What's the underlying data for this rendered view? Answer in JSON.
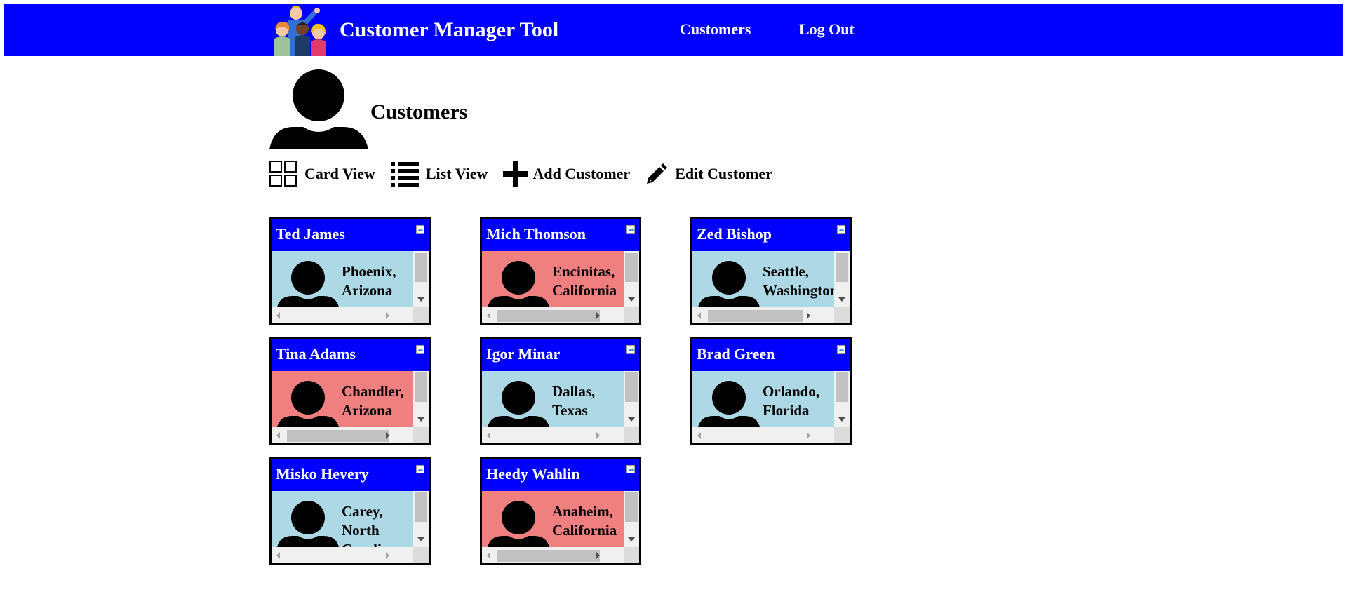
{
  "header": {
    "title": "Customer Manager Tool",
    "nav": [
      {
        "label": "Customers"
      },
      {
        "label": "Log Out"
      }
    ],
    "bg_color": "#0000ff"
  },
  "page": {
    "title": "Customers"
  },
  "toolbar": {
    "card_view": "Card View",
    "list_view": "List View",
    "add_customer": "Add Customer",
    "edit_customer": "Edit Customer"
  },
  "customers": [
    {
      "name": "Ted James",
      "city": "Phoenix,",
      "state": "Arizona",
      "color": "blue"
    },
    {
      "name": "Mich Thomson",
      "city": "Encinitas,",
      "state": "California",
      "color": "red"
    },
    {
      "name": "Zed Bishop",
      "city": "Seattle,",
      "state": "Washington",
      "color": "blue"
    },
    {
      "name": "Tina Adams",
      "city": "Chandler,",
      "state": "Arizona",
      "color": "red"
    },
    {
      "name": "Igor Minar",
      "city": "Dallas,",
      "state": "Texas",
      "color": "blue"
    },
    {
      "name": "Brad Green",
      "city": "Orlando,",
      "state": "Florida",
      "color": "blue"
    },
    {
      "name": "Misko Hevery",
      "city": "Carey,",
      "state": "North Carolina",
      "color": "blue"
    },
    {
      "name": "Heedy Wahlin",
      "city": "Anaheim,",
      "state": "California",
      "color": "red"
    }
  ],
  "colors": {
    "card_blue": "#add8e6",
    "card_red": "#f08080"
  }
}
